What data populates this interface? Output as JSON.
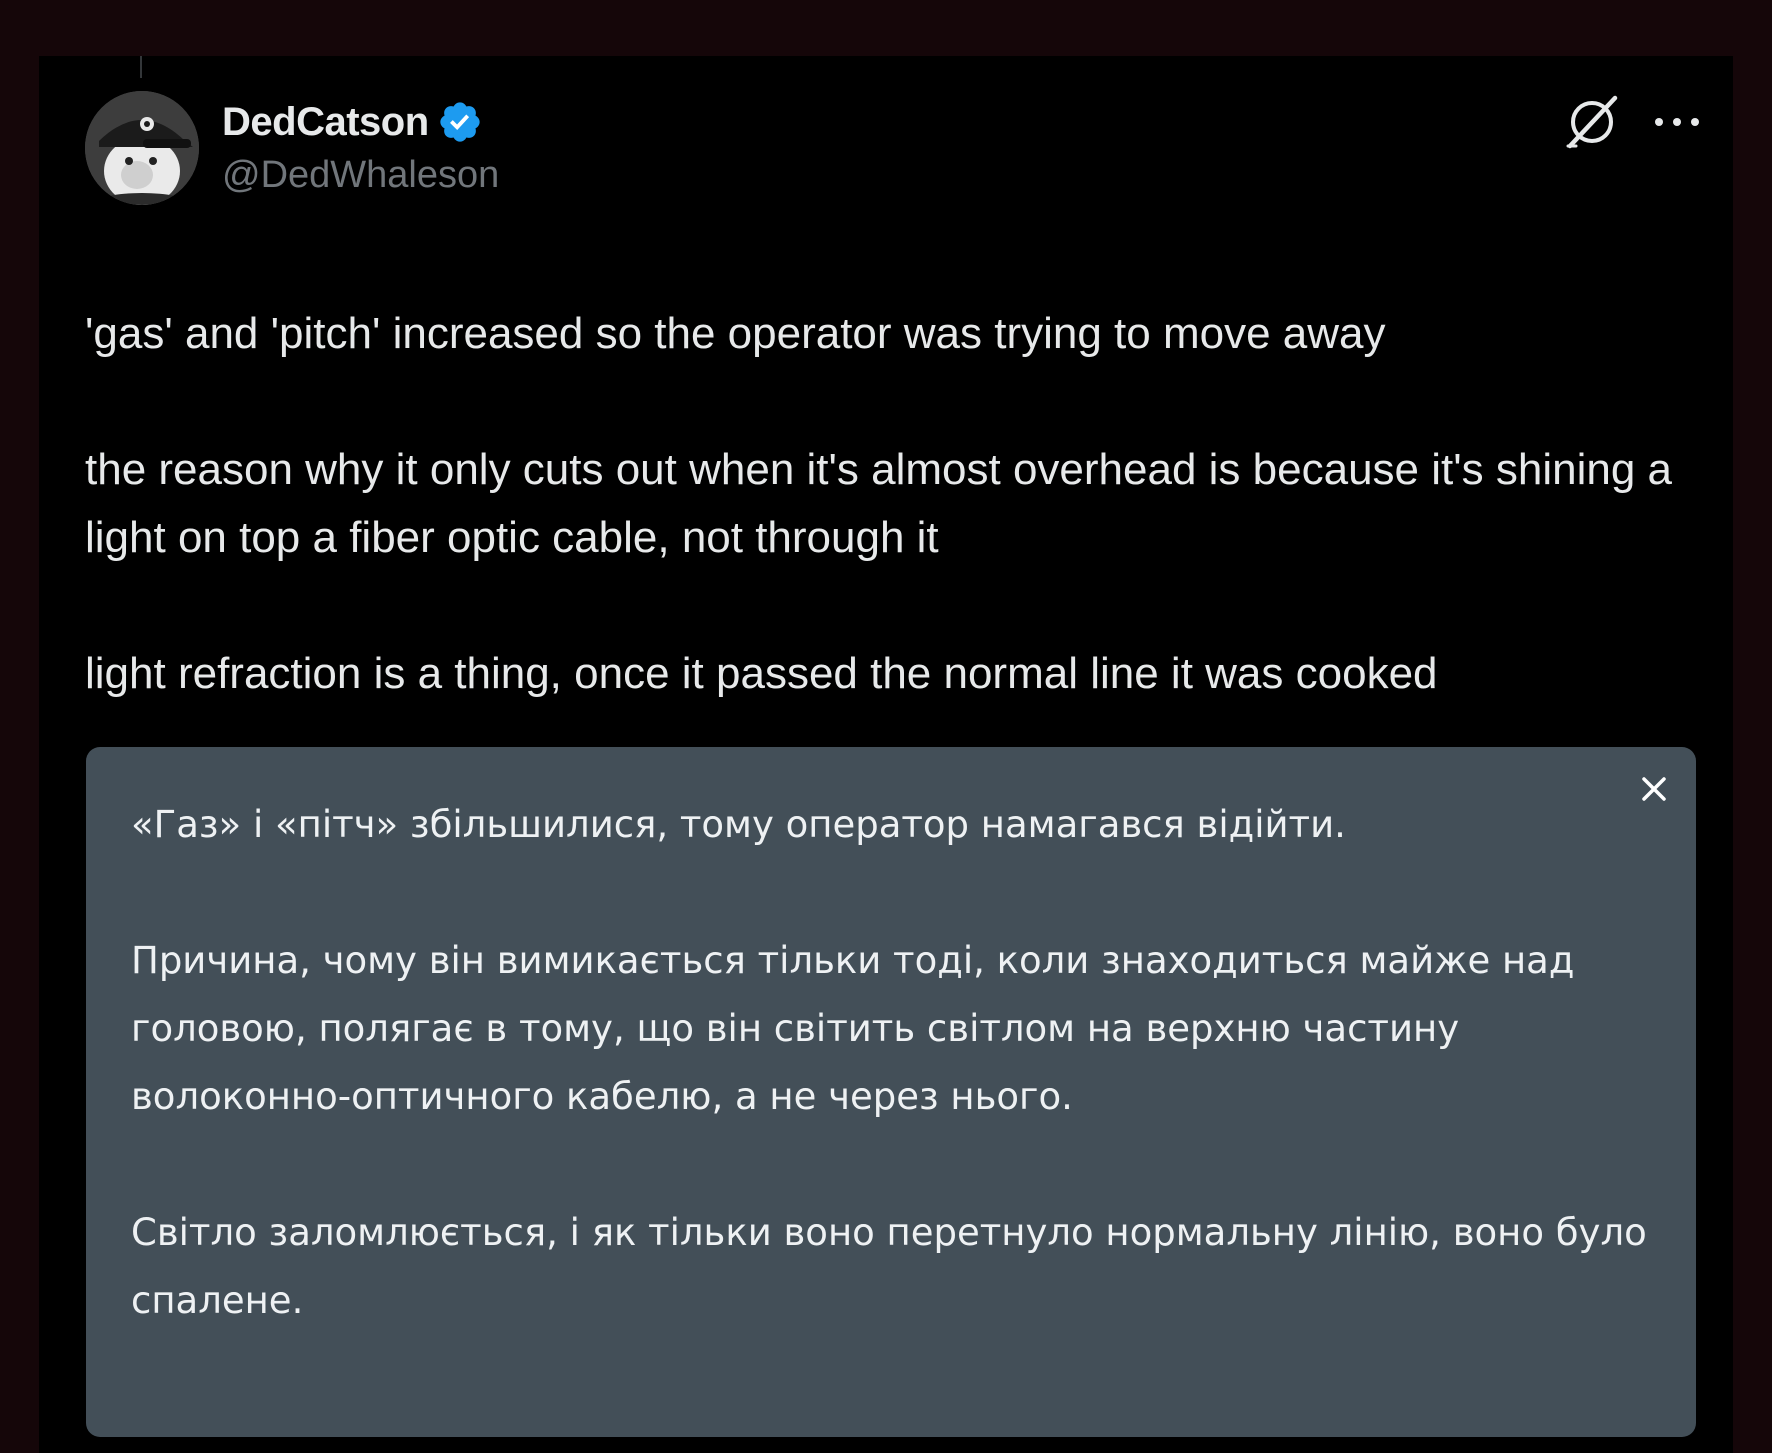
{
  "post": {
    "author": {
      "display_name": "DedCatson",
      "handle": "@DedWhaleson",
      "verified": true,
      "verified_color": "#1d9bf0",
      "avatar_icon": "cartoon-character-with-cap-avatar"
    },
    "actions": {
      "grok_icon": "grok-icon",
      "more_icon": "more-horizontal-icon"
    },
    "paragraphs": [
      "'gas' and 'pitch' increased so the operator was trying to move away",
      "the reason why it only cuts out when it's almost overhead is because it's shining a light on top a fiber optic cable, not through it",
      "light refraction is a thing, once it passed the normal line it was cooked"
    ]
  },
  "translation": {
    "close_icon": "close-icon",
    "paragraphs": [
      "«Газ» і «пітч» збільшилися, тому оператор намагався відійти.",
      "Причина, чому він вимикається тільки тоді, коли знаходиться майже над головою, полягає в тому, що він світить світлом на верхню частину волоконно-оптичного кабелю, а не через нього.",
      "Світло заломлюється, і як тільки воно перетнуло нормальну лінію, воно було спалене."
    ]
  },
  "colors": {
    "page_background": "#150609",
    "post_background": "#000000",
    "primary_text": "#e7e9ea",
    "secondary_text": "#71767b",
    "translation_background": "#434f58"
  }
}
